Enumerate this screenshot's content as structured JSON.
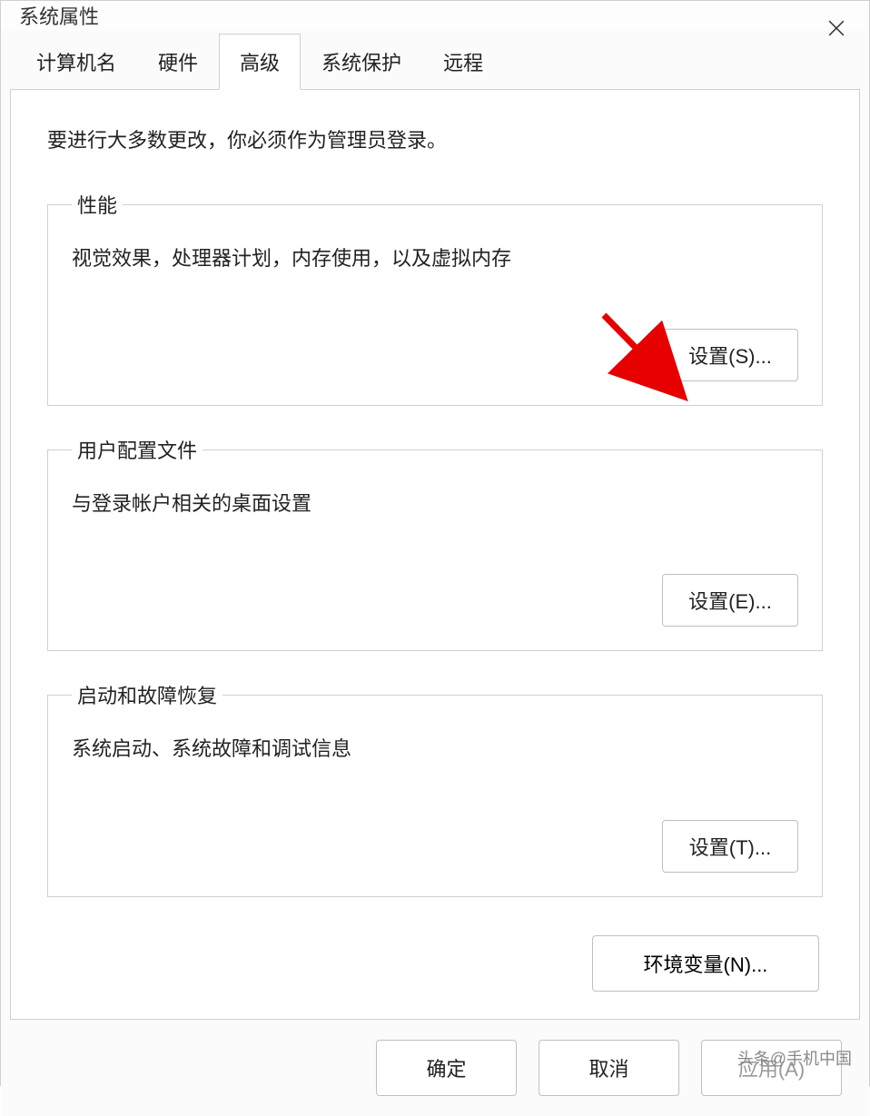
{
  "window": {
    "title": "系统属性"
  },
  "tabs": {
    "computer_name": "计算机名",
    "hardware": "硬件",
    "advanced": "高级",
    "system_protection": "系统保护",
    "remote": "远程"
  },
  "advanced_panel": {
    "intro": "要进行大多数更改，你必须作为管理员登录。",
    "performance": {
      "legend": "性能",
      "desc": "视觉效果，处理器计划，内存使用，以及虚拟内存",
      "button": "设置(S)..."
    },
    "user_profiles": {
      "legend": "用户配置文件",
      "desc": "与登录帐户相关的桌面设置",
      "button": "设置(E)..."
    },
    "startup_recovery": {
      "legend": "启动和故障恢复",
      "desc": "系统启动、系统故障和调试信息",
      "button": "设置(T)..."
    },
    "env_vars_button": "环境变量(N)..."
  },
  "footer": {
    "ok": "确定",
    "cancel": "取消",
    "apply": "应用(A)"
  },
  "watermark": "头条@手机中国"
}
